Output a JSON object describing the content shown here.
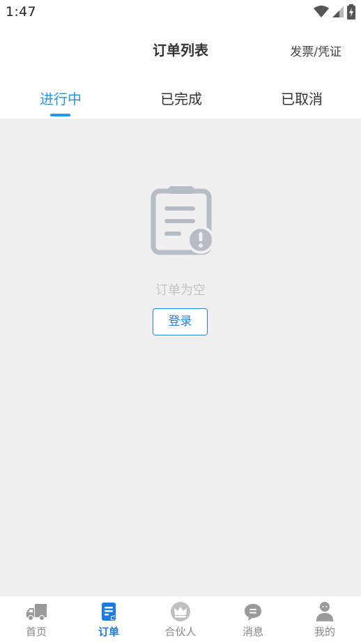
{
  "status_bar": {
    "time": "1:47"
  },
  "header": {
    "title": "订单列表",
    "invoice_link": "发票/凭证"
  },
  "tabs": [
    {
      "label": "进行中"
    },
    {
      "label": "已完成"
    },
    {
      "label": "已取消"
    }
  ],
  "empty_state": {
    "message": "订单为空",
    "login_label": "登录"
  },
  "bottom_nav": [
    {
      "label": "首页"
    },
    {
      "label": "订单"
    },
    {
      "label": "合伙人"
    },
    {
      "label": "消息"
    },
    {
      "label": "我的"
    }
  ],
  "colors": {
    "accent": "#2d95e6",
    "nav_active": "#1e7be0",
    "background": "#f0f0f0",
    "icon_gray": "#b8bcc6"
  }
}
